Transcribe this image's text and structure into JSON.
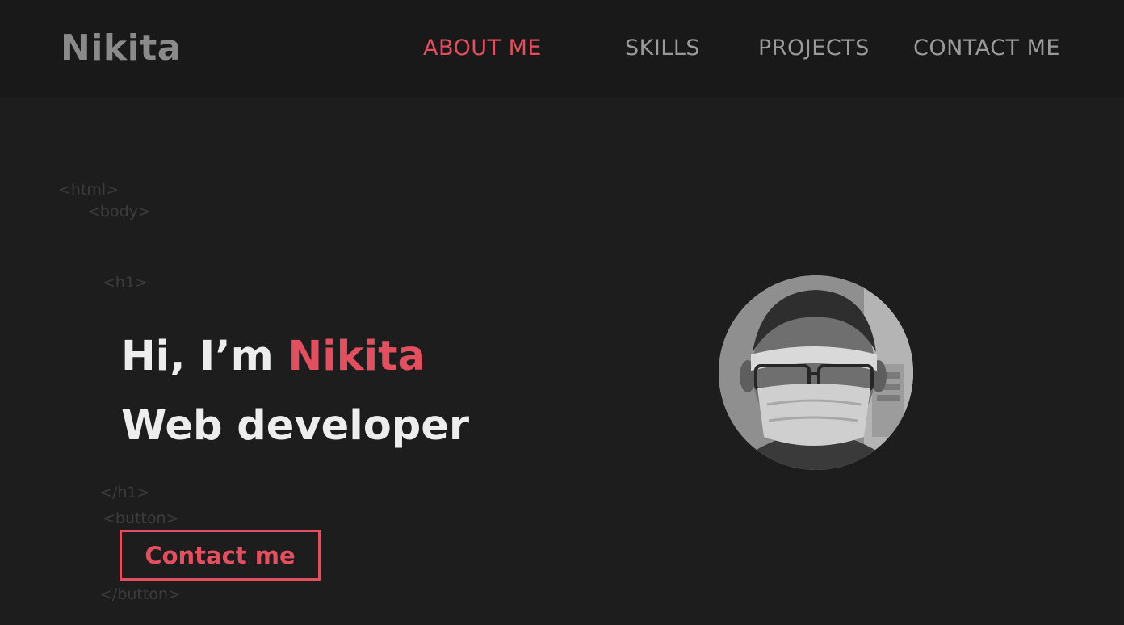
{
  "header": {
    "logo": "Nikita",
    "nav": {
      "about": "ABOUT ME",
      "skills": "SKILLS",
      "projects": "PROJECTS",
      "contact": "CONTACT ME"
    },
    "active_item": "about"
  },
  "code_tags": {
    "html_open": "<html>",
    "body_open": "<body>",
    "h1_open": "<h1>",
    "h1_close": "</h1>",
    "button_open": "<button>",
    "button_close": "</button>"
  },
  "hero": {
    "greeting": "Hi, I’m ",
    "name": "Nikita",
    "role": "Web developer",
    "cta_label": "Contact me"
  },
  "avatar": {
    "description_icon": "profile-photo"
  },
  "colors": {
    "accent": "#e24f5f",
    "background": "#1d1d1d",
    "header_background": "#191919",
    "nav_text": "#9a9a9a",
    "headline_text": "#ededed",
    "code_tag_text": "#3c3c3c"
  }
}
